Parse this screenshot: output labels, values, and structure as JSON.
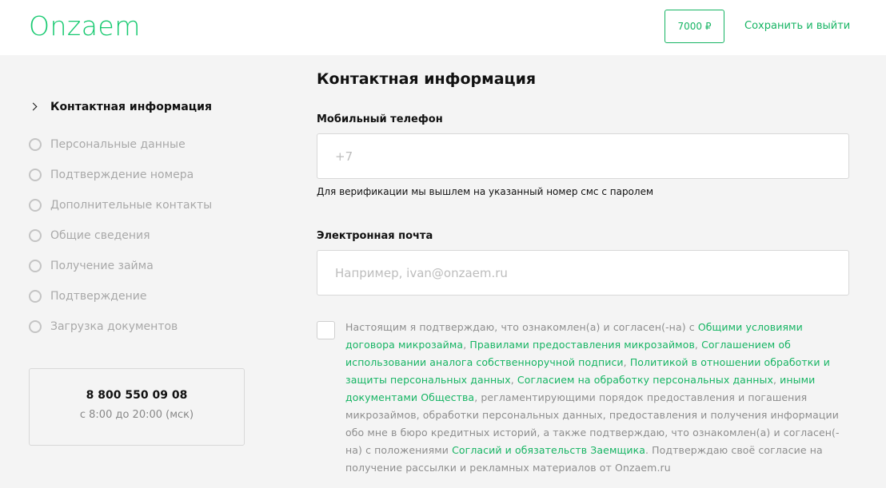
{
  "header": {
    "logo": "Onzaem",
    "amount": "7000 ₽",
    "save_exit": "Сохранить и выйти"
  },
  "sidebar": {
    "steps": [
      {
        "label": "Контактная информация",
        "active": true
      },
      {
        "label": "Персональные данные",
        "active": false
      },
      {
        "label": "Подтверждение номера",
        "active": false
      },
      {
        "label": "Дополнительные контакты",
        "active": false
      },
      {
        "label": "Общие сведения",
        "active": false
      },
      {
        "label": "Получение займа",
        "active": false
      },
      {
        "label": "Подтверждение",
        "active": false
      },
      {
        "label": "Загрузка документов",
        "active": false
      }
    ],
    "support": {
      "phone": "8 800 550 09 08",
      "hours": "с 8:00 до 20:00 (мск)"
    }
  },
  "form": {
    "title": "Контактная информация",
    "phone": {
      "label": "Мобильный телефон",
      "placeholder": "+7",
      "hint": "Для верификации мы вышлем на указанный номер смс с паролем"
    },
    "email": {
      "label": "Электронная почта",
      "placeholder": "Например, ivan@onzaem.ru"
    },
    "consent": {
      "parts": [
        {
          "text": "Настоящим я подтверждаю, что ознакомлен(а) и согласен(-на) с ",
          "link": false
        },
        {
          "text": "Общими условиями договора микрозайма",
          "link": true
        },
        {
          "text": ", ",
          "link": false
        },
        {
          "text": "Правилами предоставления микрозаймов",
          "link": true
        },
        {
          "text": ", ",
          "link": false
        },
        {
          "text": "Соглашением об использовании аналога собственноручной подписи",
          "link": true
        },
        {
          "text": ", ",
          "link": false
        },
        {
          "text": "Политикой в отношении обработки и защиты персональных данных",
          "link": true
        },
        {
          "text": ", ",
          "link": false
        },
        {
          "text": "Согласием на обработку персональных данных",
          "link": true
        },
        {
          "text": ", ",
          "link": false
        },
        {
          "text": "иными документами Общества",
          "link": true
        },
        {
          "text": ", регламентирующими порядок предоставления и погашения микрозаймов, обработки персональных данных, предоставления и получения информации обо мне в бюро кредитных историй, а также подтверждаю, что ознакомлен(а) и согласен(-на) с положениями ",
          "link": false
        },
        {
          "text": "Согласий и обязательств Заемщика",
          "link": true
        },
        {
          "text": ". Подтверждаю своё согласие на получение рассылки и рекламных материалов от Onzaem.ru",
          "link": false
        }
      ]
    }
  },
  "colors": {
    "brand": "#15c96f",
    "link": "#16b463",
    "background": "#f4f4f4"
  }
}
